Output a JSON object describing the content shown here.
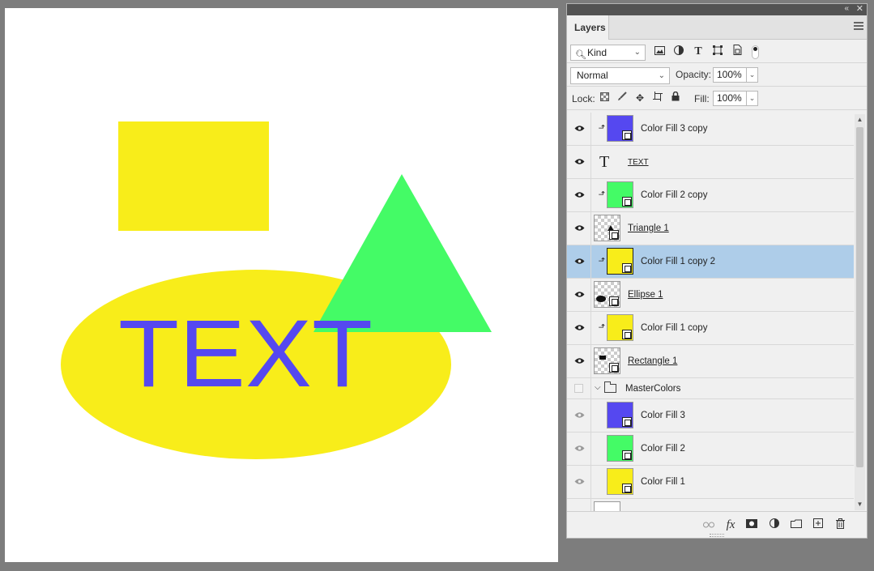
{
  "canvas": {
    "text": "TEXT",
    "colors": {
      "yellow": "#f8ed1a",
      "green": "#44fb66",
      "blue": "#5548f0",
      "background": "#ffffff"
    }
  },
  "panel": {
    "tab": "Layers",
    "filter": {
      "kind_label": "Kind",
      "icons": [
        "image-filter-icon",
        "adjustment-filter-icon",
        "type-filter-icon",
        "shape-filter-icon",
        "smart-object-filter-icon"
      ]
    },
    "blend_mode": "Normal",
    "opacity_label": "Opacity:",
    "opacity_value": "100%",
    "lock_label": "Lock:",
    "fill_label": "Fill:",
    "fill_value": "100%"
  },
  "layers": [
    {
      "name": "Color Fill 3 copy",
      "visible": true,
      "clipped": true,
      "thumb": "color",
      "color": "#5548f0",
      "selected": false,
      "kind": "fill"
    },
    {
      "name": "TEXT",
      "visible": true,
      "clipped": false,
      "thumb": "type",
      "selected": false,
      "kind": "type"
    },
    {
      "name": "Color Fill 2 copy",
      "visible": true,
      "clipped": true,
      "thumb": "color",
      "color": "#44fb66",
      "selected": false,
      "kind": "fill"
    },
    {
      "name": "Triangle 1",
      "visible": true,
      "clipped": false,
      "thumb": "shape",
      "selected": false,
      "kind": "shape"
    },
    {
      "name": "Color Fill 1 copy 2",
      "visible": true,
      "clipped": true,
      "thumb": "color",
      "color": "#f8ed1a",
      "selected": true,
      "kind": "fill"
    },
    {
      "name": "Ellipse 1",
      "visible": true,
      "clipped": false,
      "thumb": "shape",
      "selected": false,
      "kind": "shape"
    },
    {
      "name": "Color Fill 1 copy",
      "visible": true,
      "clipped": true,
      "thumb": "color",
      "color": "#f8ed1a",
      "selected": false,
      "kind": "fill"
    },
    {
      "name": "Rectangle 1",
      "visible": true,
      "clipped": false,
      "thumb": "shape",
      "selected": false,
      "kind": "shape"
    },
    {
      "name": "MasterColors",
      "visible": false,
      "clipped": false,
      "thumb": "group",
      "selected": false,
      "kind": "group"
    },
    {
      "name": "Color Fill 3",
      "visible": true,
      "clipped": false,
      "thumb": "color",
      "color": "#5548f0",
      "selected": false,
      "kind": "fill",
      "dim": true
    },
    {
      "name": "Color Fill 2",
      "visible": true,
      "clipped": false,
      "thumb": "color",
      "color": "#44fb66",
      "selected": false,
      "kind": "fill",
      "dim": true
    },
    {
      "name": "Color Fill 1",
      "visible": true,
      "clipped": false,
      "thumb": "color",
      "color": "#f8ed1a",
      "selected": false,
      "kind": "fill",
      "dim": true
    },
    {
      "name": "",
      "visible": false,
      "clipped": false,
      "thumb": "white",
      "selected": false,
      "kind": "background"
    }
  ],
  "bottom_toolbar": [
    "link-layers-icon",
    "fx-icon",
    "add-mask-icon",
    "adjustment-layer-icon",
    "new-group-icon",
    "new-layer-icon",
    "delete-layer-icon"
  ]
}
